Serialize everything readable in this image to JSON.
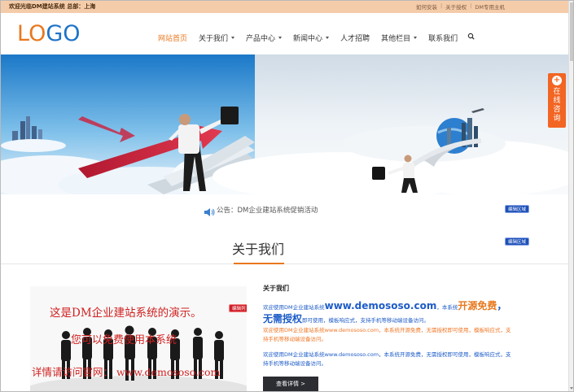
{
  "topbar": {
    "welcome": "欢迎光临DM建站系统 总部：上海",
    "links": [
      "如何安装",
      "关于授权",
      "DM专用主机"
    ]
  },
  "logo": {
    "part1": "LO",
    "part2": "GO"
  },
  "nav": {
    "items": [
      {
        "label": "网站首页",
        "active": true,
        "dropdown": false
      },
      {
        "label": "关于我们",
        "active": false,
        "dropdown": true
      },
      {
        "label": "产品中心",
        "active": false,
        "dropdown": true
      },
      {
        "label": "新闻中心",
        "active": false,
        "dropdown": true
      },
      {
        "label": "人才招聘",
        "active": false,
        "dropdown": false
      },
      {
        "label": "其他栏目",
        "active": false,
        "dropdown": true
      },
      {
        "label": "联系我们",
        "active": false,
        "dropdown": false
      }
    ],
    "search_icon": "search-icon"
  },
  "consult": {
    "label": "在线咨询",
    "icon": "plus-icon"
  },
  "notice": {
    "text": "公告：DM企业建站系统促销活动",
    "icon": "speaker-icon"
  },
  "badges": {
    "edit_area": "编辑区域",
    "edit_item": "编辑列"
  },
  "about": {
    "title": "关于我们",
    "heading": "关于我们",
    "image_captions": [
      "这是DM企业建站系统的演示。",
      "您可以免费使用本系统",
      "详情请访问官网： www.demososo.com"
    ],
    "p1_a": "欢迎使用DM企业建站系统",
    "p1_url": "www.demososo.com",
    "p1_b": "，本系统",
    "p1_free": "开源免费",
    "p1_c": "，",
    "p1_noauth": "无需授权",
    "p1_d": "即可使用，模板响应式，支持手机等移动端设备访问。",
    "p2": "欢迎使用DM企业建站系统www.demososo.com，本系统开源免费，无需授权即可使用，模板响应式，支持手机等移动端设备访问。",
    "p3": "欢迎使用DM企业建站系统www.demososo.com，本系统开源免费，无需授权即可使用，模板响应式，支持手机等移动端设备访问。",
    "more_button": "查看详情 >"
  },
  "colors": {
    "accent": "#e8781e",
    "brand_blue": "#1e73c8",
    "topbar_bg": "#f5ccaa",
    "consult_bg": "#f26522",
    "badge_bg": "#1e50b8"
  }
}
